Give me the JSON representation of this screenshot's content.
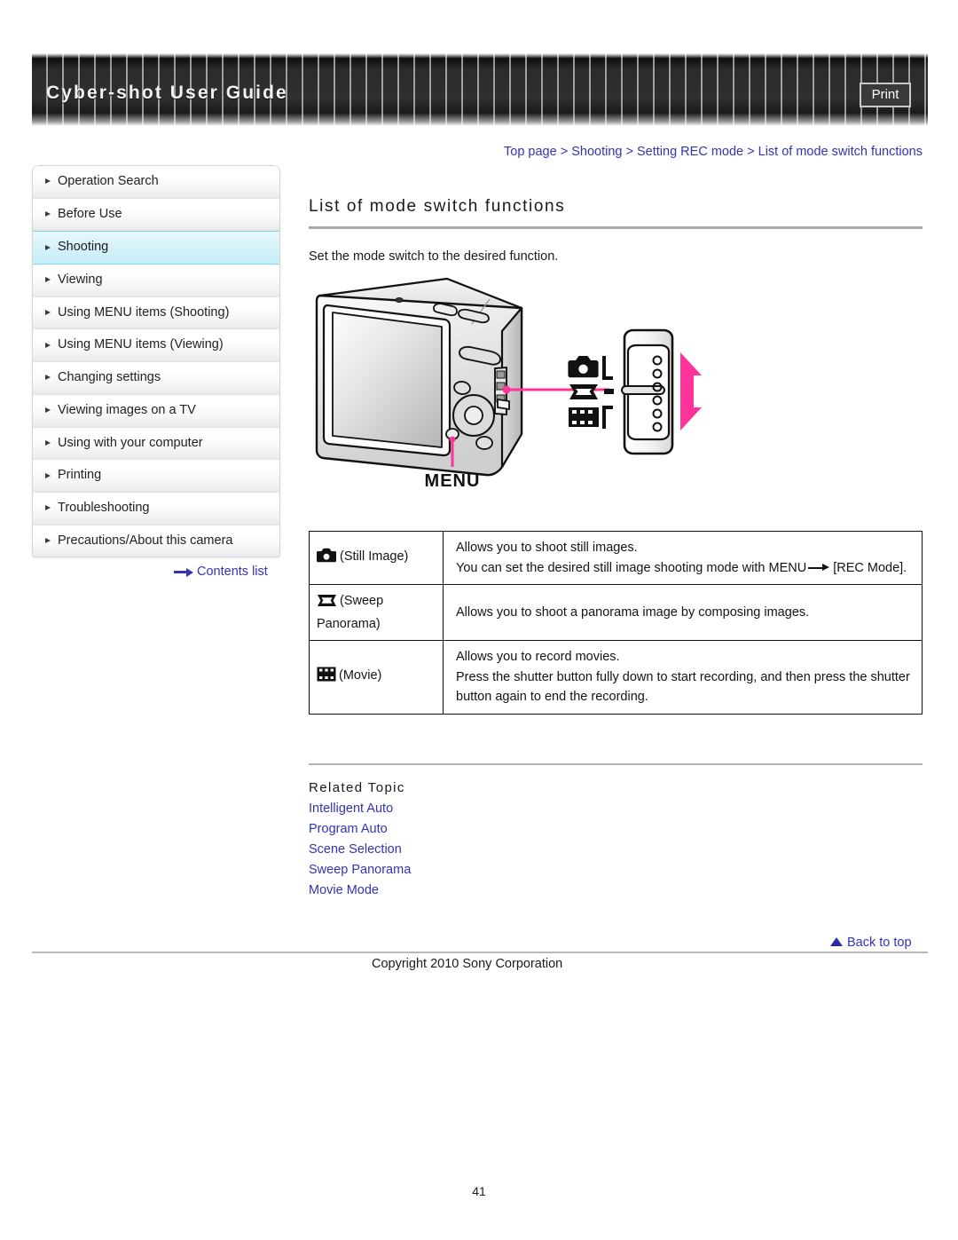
{
  "header": {
    "title": "Cyber-shot User Guide",
    "print_label": "Print"
  },
  "breadcrumb": {
    "items": [
      "Top page",
      "Shooting",
      "Setting REC mode",
      "List of mode switch functions"
    ],
    "separator": ">"
  },
  "sidebar": {
    "items": [
      {
        "label": "Operation Search",
        "active": false
      },
      {
        "label": "Before Use",
        "active": false
      },
      {
        "label": "Shooting",
        "active": true
      },
      {
        "label": "Viewing",
        "active": false
      },
      {
        "label": "Using MENU items (Shooting)",
        "active": false
      },
      {
        "label": "Using MENU items (Viewing)",
        "active": false
      },
      {
        "label": "Changing settings",
        "active": false
      },
      {
        "label": "Viewing images on a TV",
        "active": false
      },
      {
        "label": "Using with your computer",
        "active": false
      },
      {
        "label": "Printing",
        "active": false
      },
      {
        "label": "Troubleshooting",
        "active": false
      },
      {
        "label": "Precautions/About this camera",
        "active": false
      }
    ],
    "contents_list_label": "Contents list"
  },
  "main": {
    "title": "List of mode switch functions",
    "intro": "Set the mode switch to the desired function.",
    "figure": {
      "menu_label": "MENU",
      "mode_icons": [
        "still-image-icon",
        "sweep-panorama-icon",
        "movie-icon"
      ],
      "accent_color": "#ff3399"
    },
    "table": {
      "rows": [
        {
          "icon": "still-image-icon",
          "mode": "(Still Image)",
          "desc_line1": "Allows you to shoot still images.",
          "desc_line2_a": "You can set the desired still image shooting mode with MENU",
          "desc_line2_b": "[REC Mode]."
        },
        {
          "icon": "sweep-panorama-icon",
          "mode": "(Sweep Panorama)",
          "desc_line1": "Allows you to shoot a panorama image by composing images.",
          "desc_line2_a": "",
          "desc_line2_b": ""
        },
        {
          "icon": "movie-icon",
          "mode": "(Movie)",
          "desc_line1": "Allows you to record movies.",
          "desc_line2_a": "Press the shutter button fully down to start recording, and then press the shutter button again to end the recording.",
          "desc_line2_b": ""
        }
      ]
    },
    "related": {
      "heading": "Related Topic",
      "links": [
        "Intelligent Auto",
        "Program Auto",
        "Scene Selection",
        "Sweep Panorama",
        "Movie Mode"
      ]
    }
  },
  "footer": {
    "back_to_top": "Back to top",
    "copyright": "Copyright 2010 Sony Corporation",
    "page_number": "41"
  },
  "colors": {
    "link": "#3333b5",
    "accent_pink": "#ff3399",
    "active_nav_bg": "#cdf0fa",
    "banner_dark": "#2b2b2b"
  }
}
